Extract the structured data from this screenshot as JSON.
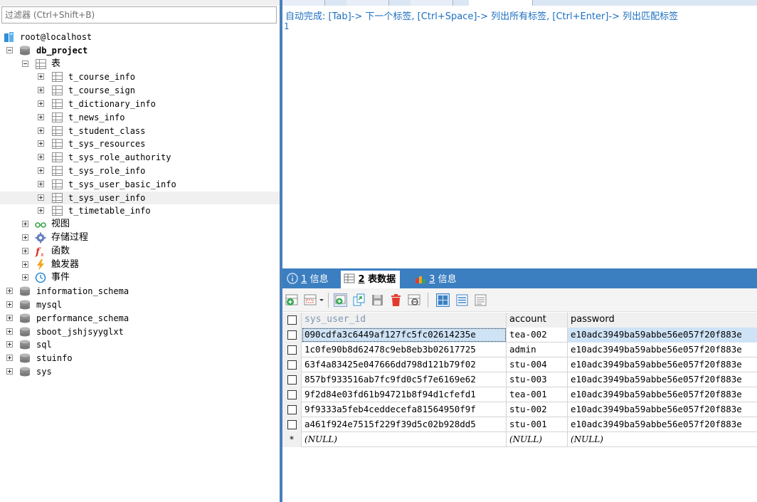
{
  "filter": {
    "placeholder": "过滤器 (Ctrl+Shift+B)"
  },
  "tree": {
    "connection": "root@localhost",
    "database": "db_project",
    "tables_folder": "表",
    "tables": [
      "t_course_info",
      "t_course_sign",
      "t_dictionary_info",
      "t_news_info",
      "t_student_class",
      "t_sys_resources",
      "t_sys_role_authority",
      "t_sys_role_info",
      "t_sys_user_basic_info",
      "t_sys_user_info",
      "t_timetable_info"
    ],
    "folders": [
      "视图",
      "存储过程",
      "函数",
      "触发器",
      "事件"
    ],
    "other_databases": [
      "information_schema",
      "mysql",
      "performance_schema",
      "sboot_jshjsyyglxt",
      "sql",
      "stuinfo",
      "sys"
    ]
  },
  "editor": {
    "hint": "自动完成: [Tab]-> 下一个标签, [Ctrl+Space]-> 列出所有标签, [Ctrl+Enter]-> 列出匹配标签",
    "line_number": "1"
  },
  "result_tabs": [
    {
      "num": "1",
      "label": "信息"
    },
    {
      "num": "2",
      "label": "表数据"
    },
    {
      "num": "3",
      "label": "信息"
    }
  ],
  "grid": {
    "columns": [
      "sys_user_id",
      "account",
      "password"
    ],
    "rows": [
      [
        "090cdfa3c6449af127fc5fc02614235e",
        "tea-002",
        "e10adc3949ba59abbe56e057f20f883e"
      ],
      [
        "1c0fe90b8d62478c9eb8eb3b02617725",
        "admin",
        "e10adc3949ba59abbe56e057f20f883e"
      ],
      [
        "63f4a83425e047666dd798d121b79f02",
        "stu-004",
        "e10adc3949ba59abbe56e057f20f883e"
      ],
      [
        "857bf933516ab7fc9fd0c5f7e6169e62",
        "stu-003",
        "e10adc3949ba59abbe56e057f20f883e"
      ],
      [
        "9f2d84e03fd61b94721b8f94d1cfefd1",
        "tea-001",
        "e10adc3949ba59abbe56e057f20f883e"
      ],
      [
        "9f9333a5feb4ceddecefa81564950f9f",
        "stu-002",
        "e10adc3949ba59abbe56e057f20f883e"
      ],
      [
        "a461f924e7515f229f39d5c02b928dd5",
        "stu-001",
        "e10adc3949ba59abbe56e057f20f883e"
      ]
    ],
    "new_row_marker": "*",
    "null_text": "(NULL)"
  },
  "colors": {
    "accent": "#3c7fc1",
    "hint_text": "#1b6fc2",
    "selection": "#cfe3f6"
  }
}
